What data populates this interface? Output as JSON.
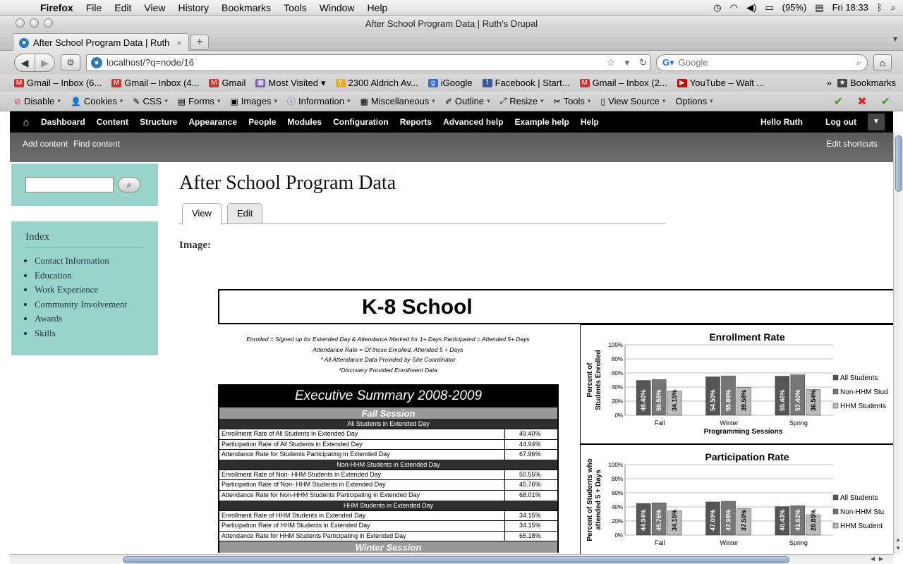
{
  "os_menubar": {
    "app": "Firefox",
    "menus": [
      "File",
      "Edit",
      "View",
      "History",
      "Bookmarks",
      "Tools",
      "Window",
      "Help"
    ],
    "battery": "(95%)",
    "clock": "Fri 18:33"
  },
  "window": {
    "title": "After School Program Data | Ruth's Drupal"
  },
  "tab": {
    "title": "After School Program Data | Ruth..."
  },
  "nav": {
    "url": "localhost/?q=node/16",
    "search_placeholder": "Google"
  },
  "bookmarks": {
    "items": [
      {
        "label": "Gmail – Inbox (6...",
        "color": "#c33"
      },
      {
        "label": "Gmail – Inbox (4...",
        "color": "#c33"
      },
      {
        "label": "Gmail",
        "color": "#c33"
      },
      {
        "label": "Most Visited",
        "color": "#7a5fb0"
      },
      {
        "label": "2300 Aldrich Av...",
        "color": "#e8b020"
      },
      {
        "label": "iGoogle",
        "color": "#3a6cd8"
      },
      {
        "label": "Facebook | Start...",
        "color": "#3b5998"
      },
      {
        "label": "Gmail – Inbox (2...",
        "color": "#c33"
      },
      {
        "label": "YouTube – Walt ...",
        "color": "#c00"
      }
    ],
    "bookmarks_menu": "Bookmarks"
  },
  "devbar": {
    "items": [
      "Disable",
      "Cookies",
      "CSS",
      "Forms",
      "Images",
      "Information",
      "Miscellaneous",
      "Outline",
      "Resize",
      "Tools",
      "View Source",
      "Options"
    ]
  },
  "admin_toolbar": {
    "items": [
      "Dashboard",
      "Content",
      "Structure",
      "Appearance",
      "People",
      "Modules",
      "Configuration",
      "Reports",
      "Advanced help",
      "Example help",
      "Help"
    ],
    "greeting": "Hello Ruth",
    "logout": "Log out"
  },
  "shortcuts": {
    "items": [
      "Add content",
      "Find content"
    ],
    "edit": "Edit shortcuts"
  },
  "sidebar": {
    "index_title": "Index",
    "links": [
      "Contact Information",
      "Education",
      "Work Experience",
      "Community Involvement",
      "Awards",
      "Skills"
    ]
  },
  "content": {
    "title": "After School Program Data",
    "tabs": [
      "View",
      "Edit"
    ],
    "image_label": "Image:"
  },
  "report": {
    "title": "K-8 School",
    "notes": [
      "Enrolled  = Signed up for Extended Day & Attendance Marked for 1+ Days        Participated  = Attended 5+ Days",
      "Attendance Rate  = Of those Enrolled, Attended 5 + Days",
      "* All Attendance Data Provided by Site Coordinator",
      "*Discovery Provided Enrollment Data"
    ],
    "exec_title": "Executive Summary 2008-2009",
    "session1": "Fall Session",
    "groups": [
      {
        "name": "All Students in Extended Day",
        "rows": [
          {
            "label": "Enrollment Rate of All Students in Extended Day",
            "value": "49.40%"
          },
          {
            "label": "Participation Rate of All Students in Extended Day",
            "value": "44.94%"
          },
          {
            "label": "Attendance Rate for Students Participating in Extended Day",
            "value": "67.96%"
          }
        ]
      },
      {
        "name": "Non-HHM Students in Extended Day",
        "rows": [
          {
            "label": "Enrollment Rate of Non- HHM Students in Extended Day",
            "value": "50.55%"
          },
          {
            "label": "Participation Rate of Non- HHM Students in Extended Day",
            "value": "45.76%"
          },
          {
            "label": "Attendance Rate for Non-HHM Students Participating in Extended Day",
            "value": "68.01%"
          }
        ]
      },
      {
        "name": "HHM Students in Extended Day",
        "rows": [
          {
            "label": "Enrollment Rate of HHM Students in Extended Day",
            "value": "34.15%"
          },
          {
            "label": "Participation Rate of HHM Students in Extended Day",
            "value": "34.15%"
          },
          {
            "label": "Attendance Rate for HHM Students Participating in Extended Day",
            "value": "65.18%"
          }
        ]
      }
    ],
    "session2": "Winter Session"
  },
  "chart_data": [
    {
      "type": "bar",
      "title": "Enrollment Rate",
      "xlabel": "Programming Sessions",
      "ylabel": "Percent of Students Enrolled",
      "categories": [
        "Fall",
        "Winter",
        "Spring"
      ],
      "ylim": [
        0,
        100
      ],
      "yticks": [
        "0%",
        "20%",
        "40%",
        "60%",
        "80%",
        "100%"
      ],
      "series": [
        {
          "name": "All Students",
          "values": [
            49.4,
            54.5,
            55.46
          ],
          "labels": [
            "49.40%",
            "54.50%",
            "55.46%"
          ],
          "color": "#555555"
        },
        {
          "name": "Non-HHM Stud",
          "values": [
            50.55,
            55.88,
            57.4
          ],
          "labels": [
            "50.55%",
            "55.88%",
            "57.40%"
          ],
          "color": "#777777"
        },
        {
          "name": "HHM Students",
          "values": [
            34.15,
            39.58,
            36.54
          ],
          "labels": [
            "34.15%",
            "39.58%",
            "36.54%"
          ],
          "color": "#bbbbbb"
        }
      ]
    },
    {
      "type": "bar",
      "title": "Participation Rate",
      "xlabel": "",
      "ylabel": "Percent of Students who attended 5 + Days",
      "categories": [
        "Fall",
        "Winter",
        "Spring"
      ],
      "ylim": [
        0,
        100
      ],
      "yticks": [
        "0%",
        "20%",
        "40%",
        "60%",
        "80%",
        "100%"
      ],
      "series": [
        {
          "name": "All Students",
          "values": [
            44.94,
            47.09,
            40.43
          ],
          "labels": [
            "44.94%",
            "47.09%",
            "40.43%"
          ],
          "color": "#555555"
        },
        {
          "name": "Non-HHM Stu",
          "values": [
            45.76,
            47.98,
            41.62
          ],
          "labels": [
            "45.76%",
            "47.98%",
            "41.62%"
          ],
          "color": "#777777"
        },
        {
          "name": "HHM Student",
          "values": [
            34.15,
            37.5,
            28.85
          ],
          "labels": [
            "34.15%",
            "37.50%",
            "28.85%"
          ],
          "color": "#bbbbbb"
        }
      ]
    }
  ]
}
